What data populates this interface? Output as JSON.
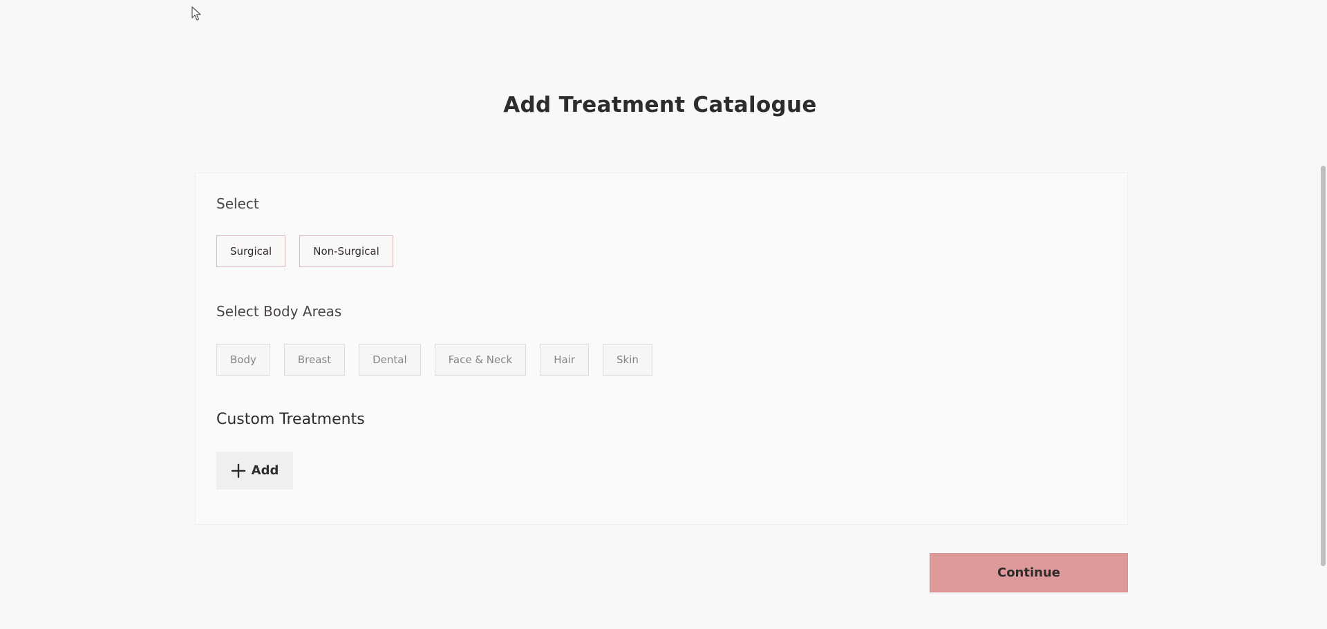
{
  "title": "Add Treatment Catalogue",
  "select_section": {
    "label": "Select",
    "options": [
      "Surgical",
      "Non-Surgical"
    ]
  },
  "body_areas_section": {
    "label": "Select Body Areas",
    "options": [
      "Body",
      "Breast",
      "Dental",
      "Face & Neck",
      "Hair",
      "Skin"
    ]
  },
  "custom_section": {
    "heading": "Custom Treatments",
    "add_label": "Add"
  },
  "continue_label": "Continue",
  "colors": {
    "accent": "#de9a9a",
    "chip_border_active": "#d9b3b5"
  },
  "icons": {
    "cursor": "mouse-pointer-icon",
    "add": "plus-icon"
  }
}
